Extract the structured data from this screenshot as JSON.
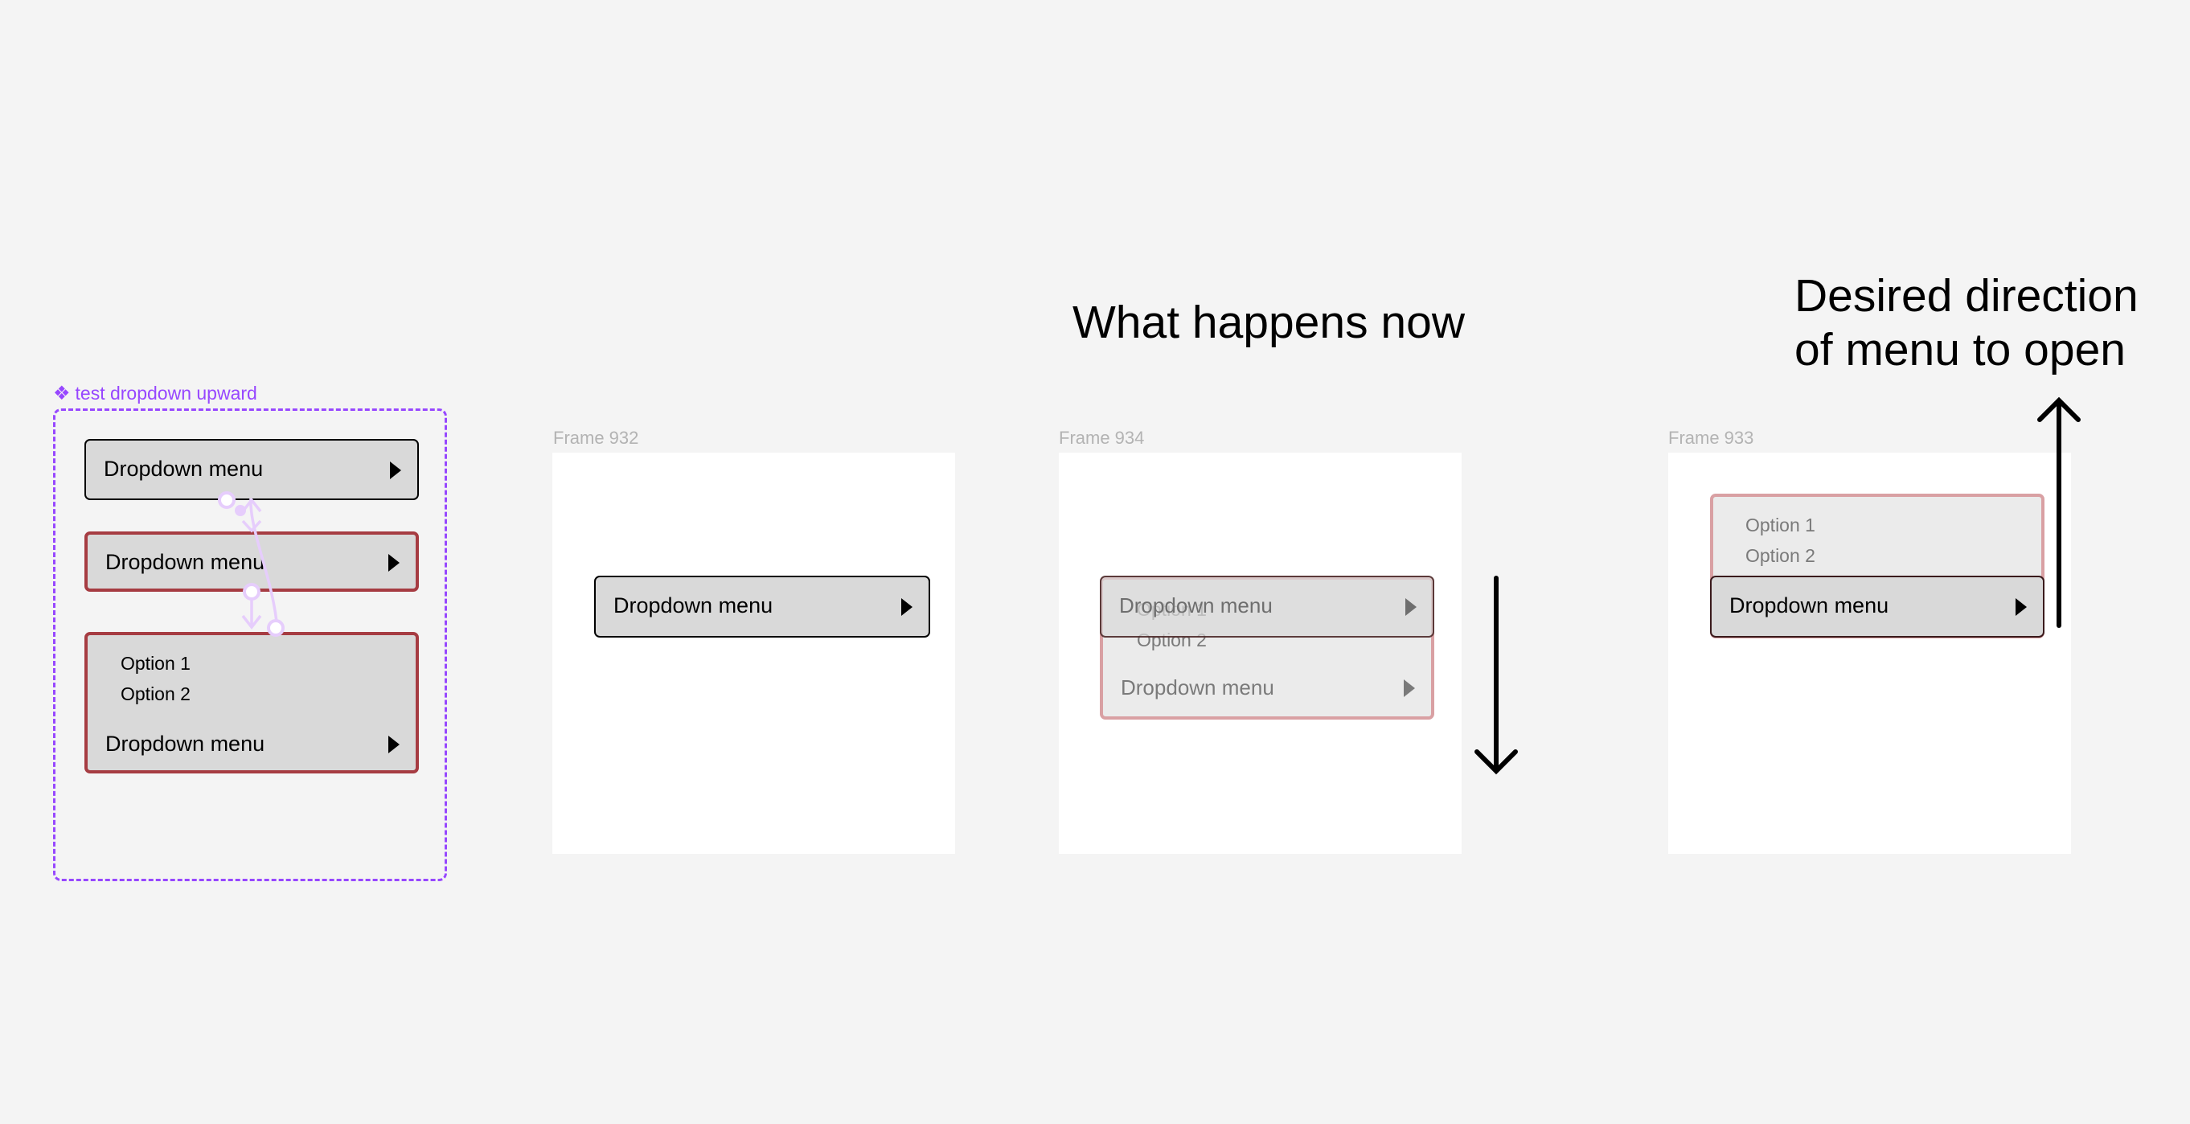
{
  "component": {
    "label": "test dropdown upward",
    "icon": "component-diamond-icon",
    "accent_color": "#9747FF",
    "variants": [
      {
        "state": "closed",
        "label": "Dropdown menu"
      },
      {
        "state": "closed-hover",
        "label": "Dropdown menu"
      },
      {
        "state": "open-upward",
        "label": "Dropdown menu",
        "options": [
          "Option 1",
          "Option 2"
        ]
      }
    ]
  },
  "frames": [
    {
      "name": "Frame 932",
      "dropdown": {
        "label": "Dropdown menu"
      }
    },
    {
      "name": "Frame 934",
      "dropdown": {
        "label": "Dropdown menu",
        "overlay_label": "Dropdown menu",
        "options": [
          "Option 1",
          "Option 2"
        ]
      }
    },
    {
      "name": "Frame 933",
      "dropdown": {
        "label": "Dropdown menu",
        "options": [
          "Option 1",
          "Option 2"
        ]
      }
    }
  ],
  "annotations": {
    "current": "What happens now",
    "desired_line1": "Desired direction",
    "desired_line2": "of menu to open"
  }
}
